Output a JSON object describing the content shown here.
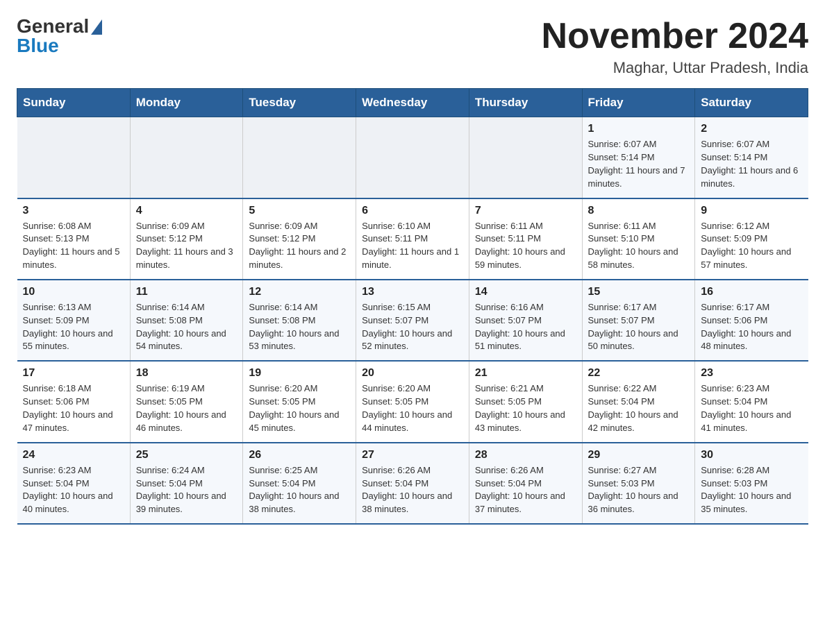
{
  "logo": {
    "general": "General",
    "blue": "Blue"
  },
  "title": "November 2024",
  "location": "Maghar, Uttar Pradesh, India",
  "weekdays": [
    "Sunday",
    "Monday",
    "Tuesday",
    "Wednesday",
    "Thursday",
    "Friday",
    "Saturday"
  ],
  "weeks": [
    [
      {
        "day": "",
        "text": ""
      },
      {
        "day": "",
        "text": ""
      },
      {
        "day": "",
        "text": ""
      },
      {
        "day": "",
        "text": ""
      },
      {
        "day": "",
        "text": ""
      },
      {
        "day": "1",
        "text": "Sunrise: 6:07 AM\nSunset: 5:14 PM\nDaylight: 11 hours and 7 minutes."
      },
      {
        "day": "2",
        "text": "Sunrise: 6:07 AM\nSunset: 5:14 PM\nDaylight: 11 hours and 6 minutes."
      }
    ],
    [
      {
        "day": "3",
        "text": "Sunrise: 6:08 AM\nSunset: 5:13 PM\nDaylight: 11 hours and 5 minutes."
      },
      {
        "day": "4",
        "text": "Sunrise: 6:09 AM\nSunset: 5:12 PM\nDaylight: 11 hours and 3 minutes."
      },
      {
        "day": "5",
        "text": "Sunrise: 6:09 AM\nSunset: 5:12 PM\nDaylight: 11 hours and 2 minutes."
      },
      {
        "day": "6",
        "text": "Sunrise: 6:10 AM\nSunset: 5:11 PM\nDaylight: 11 hours and 1 minute."
      },
      {
        "day": "7",
        "text": "Sunrise: 6:11 AM\nSunset: 5:11 PM\nDaylight: 10 hours and 59 minutes."
      },
      {
        "day": "8",
        "text": "Sunrise: 6:11 AM\nSunset: 5:10 PM\nDaylight: 10 hours and 58 minutes."
      },
      {
        "day": "9",
        "text": "Sunrise: 6:12 AM\nSunset: 5:09 PM\nDaylight: 10 hours and 57 minutes."
      }
    ],
    [
      {
        "day": "10",
        "text": "Sunrise: 6:13 AM\nSunset: 5:09 PM\nDaylight: 10 hours and 55 minutes."
      },
      {
        "day": "11",
        "text": "Sunrise: 6:14 AM\nSunset: 5:08 PM\nDaylight: 10 hours and 54 minutes."
      },
      {
        "day": "12",
        "text": "Sunrise: 6:14 AM\nSunset: 5:08 PM\nDaylight: 10 hours and 53 minutes."
      },
      {
        "day": "13",
        "text": "Sunrise: 6:15 AM\nSunset: 5:07 PM\nDaylight: 10 hours and 52 minutes."
      },
      {
        "day": "14",
        "text": "Sunrise: 6:16 AM\nSunset: 5:07 PM\nDaylight: 10 hours and 51 minutes."
      },
      {
        "day": "15",
        "text": "Sunrise: 6:17 AM\nSunset: 5:07 PM\nDaylight: 10 hours and 50 minutes."
      },
      {
        "day": "16",
        "text": "Sunrise: 6:17 AM\nSunset: 5:06 PM\nDaylight: 10 hours and 48 minutes."
      }
    ],
    [
      {
        "day": "17",
        "text": "Sunrise: 6:18 AM\nSunset: 5:06 PM\nDaylight: 10 hours and 47 minutes."
      },
      {
        "day": "18",
        "text": "Sunrise: 6:19 AM\nSunset: 5:05 PM\nDaylight: 10 hours and 46 minutes."
      },
      {
        "day": "19",
        "text": "Sunrise: 6:20 AM\nSunset: 5:05 PM\nDaylight: 10 hours and 45 minutes."
      },
      {
        "day": "20",
        "text": "Sunrise: 6:20 AM\nSunset: 5:05 PM\nDaylight: 10 hours and 44 minutes."
      },
      {
        "day": "21",
        "text": "Sunrise: 6:21 AM\nSunset: 5:05 PM\nDaylight: 10 hours and 43 minutes."
      },
      {
        "day": "22",
        "text": "Sunrise: 6:22 AM\nSunset: 5:04 PM\nDaylight: 10 hours and 42 minutes."
      },
      {
        "day": "23",
        "text": "Sunrise: 6:23 AM\nSunset: 5:04 PM\nDaylight: 10 hours and 41 minutes."
      }
    ],
    [
      {
        "day": "24",
        "text": "Sunrise: 6:23 AM\nSunset: 5:04 PM\nDaylight: 10 hours and 40 minutes."
      },
      {
        "day": "25",
        "text": "Sunrise: 6:24 AM\nSunset: 5:04 PM\nDaylight: 10 hours and 39 minutes."
      },
      {
        "day": "26",
        "text": "Sunrise: 6:25 AM\nSunset: 5:04 PM\nDaylight: 10 hours and 38 minutes."
      },
      {
        "day": "27",
        "text": "Sunrise: 6:26 AM\nSunset: 5:04 PM\nDaylight: 10 hours and 38 minutes."
      },
      {
        "day": "28",
        "text": "Sunrise: 6:26 AM\nSunset: 5:04 PM\nDaylight: 10 hours and 37 minutes."
      },
      {
        "day": "29",
        "text": "Sunrise: 6:27 AM\nSunset: 5:03 PM\nDaylight: 10 hours and 36 minutes."
      },
      {
        "day": "30",
        "text": "Sunrise: 6:28 AM\nSunset: 5:03 PM\nDaylight: 10 hours and 35 minutes."
      }
    ]
  ]
}
